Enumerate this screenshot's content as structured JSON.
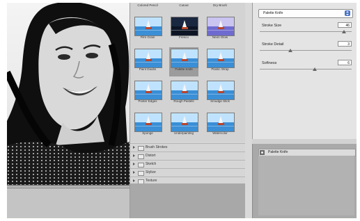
{
  "gallery": {
    "top_labels": [
      "Colored Pencil",
      "Cutout",
      "Dry Brush"
    ],
    "filters": [
      {
        "label": "Film Grain",
        "selected": false,
        "scene": "sea"
      },
      {
        "label": "Fresco",
        "selected": false,
        "scene": "dark"
      },
      {
        "label": "Neon Glow",
        "selected": false,
        "scene": "purple"
      },
      {
        "label": "Paint Daubs",
        "selected": false,
        "scene": "sea"
      },
      {
        "label": "Palette Knife",
        "selected": true,
        "scene": "sea"
      },
      {
        "label": "Plastic Wrap",
        "selected": false,
        "scene": "sea"
      },
      {
        "label": "Poster Edges",
        "selected": false,
        "scene": "sea"
      },
      {
        "label": "Rough Pastels",
        "selected": false,
        "scene": "sea"
      },
      {
        "label": "Smudge Stick",
        "selected": false,
        "scene": "sea"
      },
      {
        "label": "Sponge",
        "selected": false,
        "scene": "sea"
      },
      {
        "label": "Underpainting",
        "selected": false,
        "scene": "sea"
      },
      {
        "label": "Watercolor",
        "selected": false,
        "scene": "sea"
      }
    ],
    "groups": [
      "Brush Strokes",
      "Distort",
      "Sketch",
      "Stylize",
      "Texture"
    ]
  },
  "settings": {
    "filter_select": "Palette Knife",
    "params": [
      {
        "label": "Stroke Size",
        "value": "46",
        "level": 0.92
      },
      {
        "label": "Stroke Detail",
        "value": "3",
        "level": 0.33
      },
      {
        "label": "Softness",
        "value": "6",
        "level": 0.6
      }
    ]
  },
  "layers": {
    "items": [
      {
        "label": "Palette Knife"
      }
    ]
  },
  "colors": {
    "accent": "#4a72c7",
    "sea": "#3a8fd6",
    "sky": "#bfe3ff"
  }
}
